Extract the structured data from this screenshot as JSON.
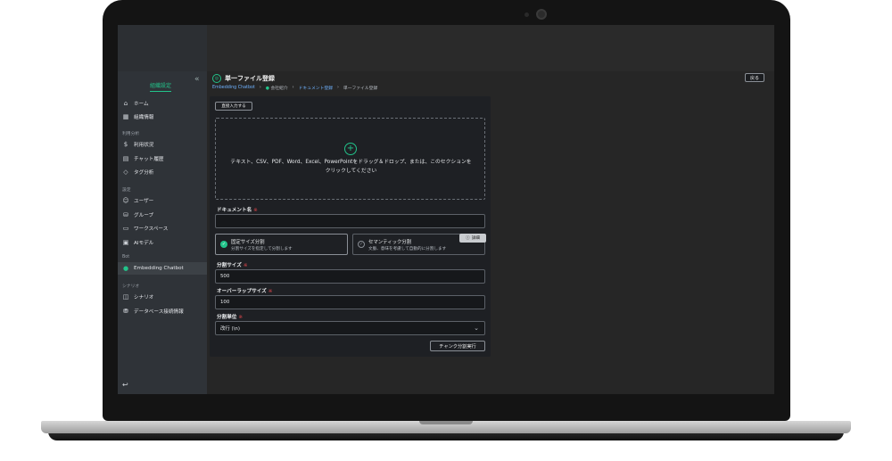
{
  "sidebar": {
    "title": "組織設定",
    "collapse": "«",
    "items": [
      {
        "label": "ホーム",
        "icon": "home-icon"
      },
      {
        "label": "組織情報",
        "icon": "building-icon"
      },
      {
        "label": "利用状況",
        "icon": "dollar-icon"
      },
      {
        "label": "チャット履歴",
        "icon": "chat-history-icon"
      },
      {
        "label": "タグ分析",
        "icon": "tag-icon"
      },
      {
        "label": "ユーザー",
        "icon": "user-icon"
      },
      {
        "label": "グループ",
        "icon": "group-icon"
      },
      {
        "label": "ワークスペース",
        "icon": "workspace-icon"
      },
      {
        "label": "AIモデル",
        "icon": "ai-model-icon"
      },
      {
        "label": "Embedding Chatbot",
        "icon": "chatbot-icon"
      },
      {
        "label": "シナリオ",
        "icon": "book-icon"
      },
      {
        "label": "データベース接続情報",
        "icon": "database-icon"
      }
    ],
    "sections": [
      "利用分析",
      "設定",
      "Bot",
      "シナリオ"
    ],
    "bottom_icon": "back-arrow-icon"
  },
  "header": {
    "title": "単一ファイル登録",
    "breadcrumb": [
      "Embedding Chatbot",
      "会社紹介",
      "ドキュメント登録",
      "単一ファイル登録"
    ],
    "back_label": "戻る"
  },
  "form": {
    "direct_input_label": "直接入力する",
    "dropzone_text_line1": "テキスト、CSV、PDF、Word、Excel、PowerPointをドラッグ＆ドロップ、または、このセクションを",
    "dropzone_text_line2": "クリックしてください",
    "document_name_label": "ドキュメント名",
    "document_name_value": "",
    "option_fixed_title": "固定サイズ分割",
    "option_fixed_desc": "分割サイズを指定して分割します",
    "option_semantic_title": "セマンティック分割",
    "option_semantic_desc": "文脈、意味を考慮して自動的に分割します",
    "detail_label": "詳細",
    "chunk_size_label": "分割サイズ",
    "chunk_size_value": "500",
    "overlap_label": "オーバーラップサイズ",
    "overlap_value": "100",
    "unit_label": "分割単位",
    "unit_value": "改行 (\\n)",
    "run_label": "チャンク分割実行",
    "required_mark": "※"
  },
  "colors": {
    "accent": "#22c38a",
    "link": "#6fb2ff",
    "required": "#e5484d"
  }
}
